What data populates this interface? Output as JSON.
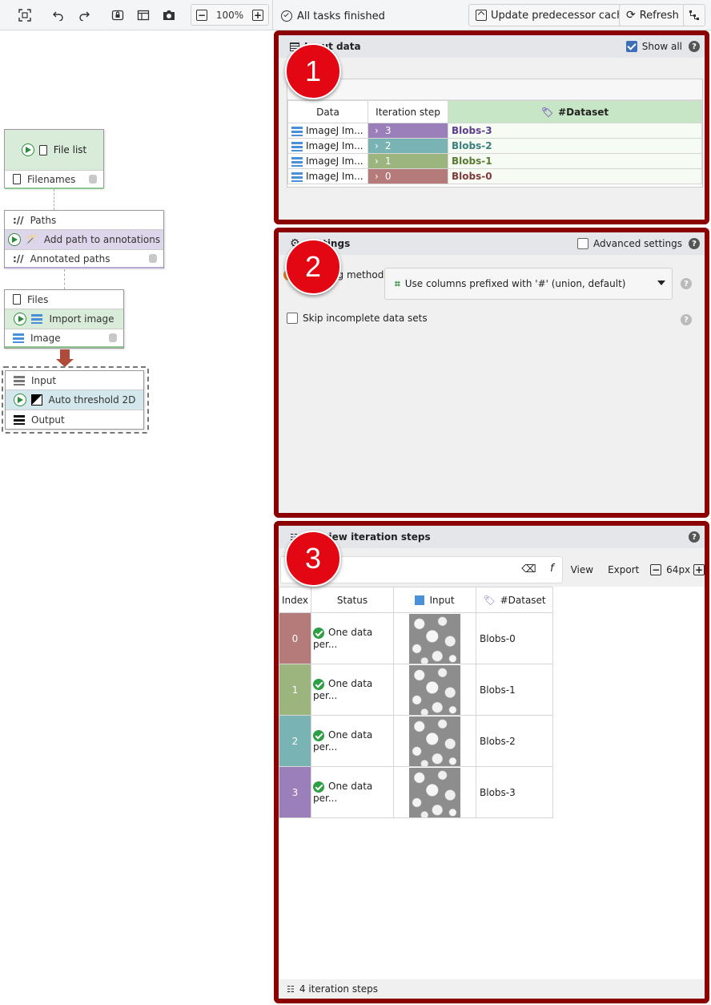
{
  "left_toolbar": {
    "zoom": "100%",
    "zoom_minus": "−",
    "zoom_plus": "+"
  },
  "right_toolbar": {
    "status": "All tasks finished",
    "update_cache_label": "Update predecessor cache",
    "refresh_label": "Refresh"
  },
  "graph": {
    "file_list": {
      "title": "File list",
      "output": "Filenames"
    },
    "add_path": {
      "input": "Paths",
      "title": "Add path to annotations",
      "output": "Annotated paths"
    },
    "import_image": {
      "input": "Files",
      "title": "Import image",
      "output": "Image"
    },
    "auto_threshold": {
      "input": "Input",
      "title": "Auto threshold 2D",
      "output": "Output"
    }
  },
  "badges": [
    "1",
    "2",
    "3"
  ],
  "input_panel": {
    "title": "Input data",
    "show_all_label": "Show all",
    "columns": [
      "Data",
      "Iteration step",
      "#Dataset"
    ],
    "rows": [
      {
        "data": "ImageJ Im...",
        "step": "3",
        "dataset": "Blobs-3",
        "color": "#9b7fba",
        "text_color": "#5e3d8a"
      },
      {
        "data": "ImageJ Im...",
        "step": "2",
        "dataset": "Blobs-2",
        "color": "#7ab3b3",
        "text_color": "#3a7f7f"
      },
      {
        "data": "ImageJ Im...",
        "step": "1",
        "dataset": "Blobs-1",
        "color": "#9cb57e",
        "text_color": "#5a7a32"
      },
      {
        "data": "ImageJ Im...",
        "step": "0",
        "dataset": "Blobs-0",
        "color": "#b57a7a",
        "text_color": "#7f3a3a"
      }
    ]
  },
  "settings_panel": {
    "title": "Settings",
    "advanced_label": "Advanced settings",
    "method_label": "Matching method",
    "method_value": "Use columns prefixed with '#' (union, default)",
    "skip_label": "Skip incomplete data sets"
  },
  "preview_panel": {
    "title": "Preview iteration steps",
    "view_label": "View",
    "export_label": "Export",
    "zoom_value": "64px",
    "columns": [
      "Index",
      "Status",
      "Input",
      "#Dataset"
    ],
    "rows": [
      {
        "index": "0",
        "status": "One data per...",
        "dataset": "Blobs-0",
        "color": "#b57a7a"
      },
      {
        "index": "1",
        "status": "One data per...",
        "dataset": "Blobs-1",
        "color": "#9cb57e"
      },
      {
        "index": "2",
        "status": "One data per...",
        "dataset": "Blobs-2",
        "color": "#7ab3b3"
      },
      {
        "index": "3",
        "status": "One data per...",
        "dataset": "Blobs-3",
        "color": "#9b7fba"
      }
    ],
    "footer": "4 iteration steps"
  }
}
